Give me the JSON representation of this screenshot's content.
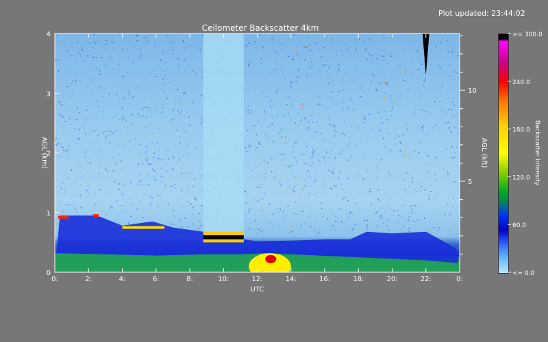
{
  "header": {
    "updated": "Plot updated: 23:44:02"
  },
  "chart_data": {
    "type": "heatmap",
    "title": "Ceilometer Backscatter 4km",
    "xlabel": "UTC",
    "ylabel_left": "AGL (km)",
    "ylabel_right": "AGL (kft)",
    "xlim": [
      0,
      24
    ],
    "ylim_km": [
      0,
      4
    ],
    "x_tick_labels": [
      "0:",
      "2:",
      "4:",
      "6:",
      "8:",
      "10:",
      "12:",
      "14:",
      "16:",
      "18:",
      "20:",
      "22:",
      "0:"
    ],
    "x_tick_values": [
      0,
      2,
      4,
      6,
      8,
      10,
      12,
      14,
      16,
      18,
      20,
      22,
      24
    ],
    "y_left_tick_labels": [
      "0",
      "1",
      "2",
      "3",
      "4"
    ],
    "y_left_tick_values": [
      0,
      1,
      2,
      3,
      4
    ],
    "y_right_tick_labels": [
      "5",
      "10"
    ],
    "y_right_tick_values_kft": [
      5,
      10
    ],
    "colorbar": {
      "label": "Backscatter Intensity",
      "tick_labels": [
        ">= 300.0",
        "240.0",
        "180.0",
        "120.0",
        "60.0",
        "<=   0.0"
      ],
      "tick_values": [
        300,
        240,
        180,
        120,
        60,
        0
      ],
      "colors": [
        "#000000",
        "#ff00ff",
        "#ff0000",
        "#ffcc00",
        "#00aa22",
        "#0033ff",
        "#bbe6ff"
      ]
    },
    "cloud_base_km": [
      {
        "x": 0.3,
        "y": 0.95
      },
      {
        "x": 2.5,
        "y": 0.95
      },
      {
        "x": 4.0,
        "y": 0.78
      },
      {
        "x": 5.8,
        "y": 0.85
      },
      {
        "x": 7.0,
        "y": 0.75
      },
      {
        "x": 8.8,
        "y": 0.68
      },
      {
        "x": 10.2,
        "y": 0.5
      },
      {
        "x": 11.2,
        "y": 0.55
      },
      {
        "x": 12.0,
        "y": 0.52
      },
      {
        "x": 14.0,
        "y": 0.53
      },
      {
        "x": 16.0,
        "y": 0.55
      },
      {
        "x": 17.5,
        "y": 0.55
      },
      {
        "x": 18.5,
        "y": 0.68
      },
      {
        "x": 20.0,
        "y": 0.65
      },
      {
        "x": 22.0,
        "y": 0.68
      },
      {
        "x": 23.8,
        "y": 0.4
      }
    ],
    "boundary_layer_km": [
      {
        "x": 0.0,
        "y": 0.32
      },
      {
        "x": 3.0,
        "y": 0.3
      },
      {
        "x": 6.0,
        "y": 0.28
      },
      {
        "x": 9.0,
        "y": 0.3
      },
      {
        "x": 11.0,
        "y": 0.3
      },
      {
        "x": 12.5,
        "y": 0.32
      },
      {
        "x": 14.0,
        "y": 0.3
      },
      {
        "x": 18.0,
        "y": 0.25
      },
      {
        "x": 22.0,
        "y": 0.2
      },
      {
        "x": 24.0,
        "y": 0.15
      }
    ],
    "high_intensity_regions": [
      {
        "name": "layer-8-11h",
        "x0": 8.8,
        "x1": 11.2,
        "y_km": 0.58,
        "intensity": 300
      },
      {
        "name": "surface-12-14h",
        "x0": 11.5,
        "x1": 14.0,
        "y_km": 0.2,
        "intensity": 180
      },
      {
        "name": "cloud-6h",
        "x0": 4.0,
        "x1": 6.5,
        "y_km": 0.75,
        "intensity": 150
      },
      {
        "name": "cloud-0h",
        "x0": 0.2,
        "x1": 0.8,
        "y_km": 0.92,
        "intensity": 200
      },
      {
        "name": "cloud-2.5h",
        "x0": 2.3,
        "x1": 2.6,
        "y_km": 0.95,
        "intensity": 200
      },
      {
        "name": "precip-22h",
        "x0": 21.8,
        "x1": 22.2,
        "y_km": 3.7,
        "intensity": 300
      }
    ]
  }
}
